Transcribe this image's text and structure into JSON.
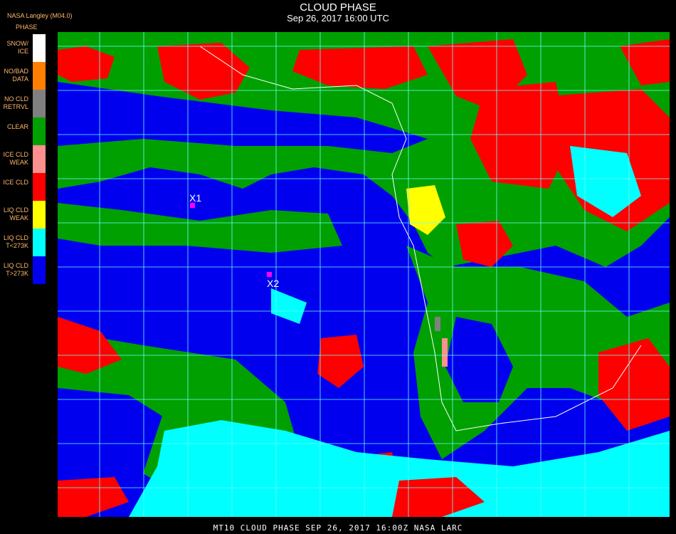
{
  "header": {
    "title": "CLOUD PHASE",
    "subtitle": "Sep 26, 2017 16:00 UTC",
    "credit": "NASA Langley (M04.0)"
  },
  "legend": {
    "title": "PHASE",
    "items": [
      {
        "label": "SNOW/\nICE",
        "color": "#ffffff"
      },
      {
        "label": "NO/BAD\nDATA",
        "color": "#ff7f00"
      },
      {
        "label": "NO CLD\nRETRVL",
        "color": "#808080"
      },
      {
        "label": "CLEAR",
        "color": "#00a000"
      },
      {
        "label": "ICE CLD\nWEAK",
        "color": "#ff9090"
      },
      {
        "label": "ICE CLD",
        "color": "#ff0000"
      },
      {
        "label": "LIQ CLD\nWEAK",
        "color": "#ffff00"
      },
      {
        "label": "LIQ CLD\nT<273K",
        "color": "#00ffff"
      },
      {
        "label": "LIQ CLD\nT>273K",
        "color": "#0000ee"
      }
    ]
  },
  "markers": [
    {
      "label": "X1",
      "color": "#ff00ff"
    },
    {
      "label": "X2",
      "color": "#ff00ff"
    }
  ],
  "footer": "MT10  CLOUD PHASE   SEP 26, 2017 16:00Z   NASA LARC"
}
